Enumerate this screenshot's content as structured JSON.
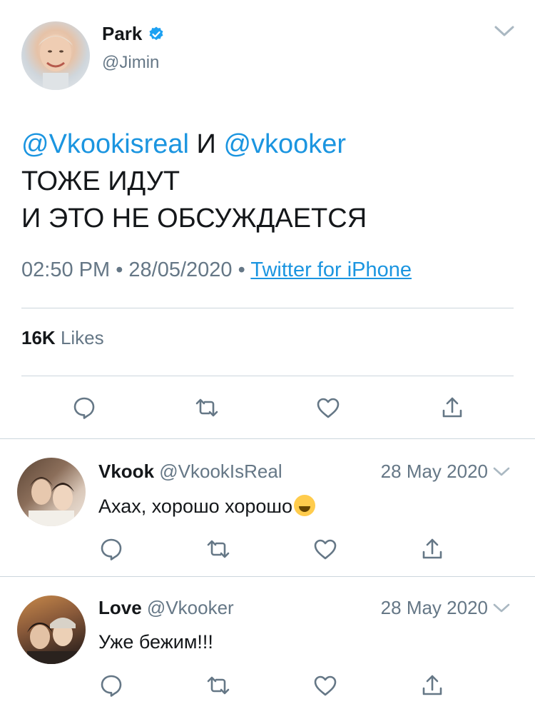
{
  "main_tweet": {
    "author_name": "Park",
    "author_handle": "@Jimin",
    "verified_icon": "verified-badge-icon",
    "text": {
      "mention1": "@Vkookisreal",
      "connector": " И ",
      "mention2": "@vkooker",
      "line2": "ТОЖЕ ИДУТ",
      "line3": "И ЭТО НЕ ОБСУЖДАЕТСЯ"
    },
    "time": "02:50 PM",
    "separator": "•",
    "date": "28/05/2020",
    "source": "Twitter for iPhone",
    "likes_count": "16K",
    "likes_label": "Likes"
  },
  "replies": [
    {
      "name": "Vkook",
      "handle": "@VkookIsReal",
      "date": "28 May 2020",
      "text": "Ахах, хорошо хорошо",
      "emoji": "laughing-tears-emoji"
    },
    {
      "name": "Love",
      "handle": "@Vkooker",
      "date": "28 May 2020",
      "text": "Уже бежим!!!"
    }
  ],
  "colors": {
    "link": "#1b95e0",
    "secondary": "#657786",
    "divider": "#ccd6dd",
    "icon": "#657786"
  }
}
